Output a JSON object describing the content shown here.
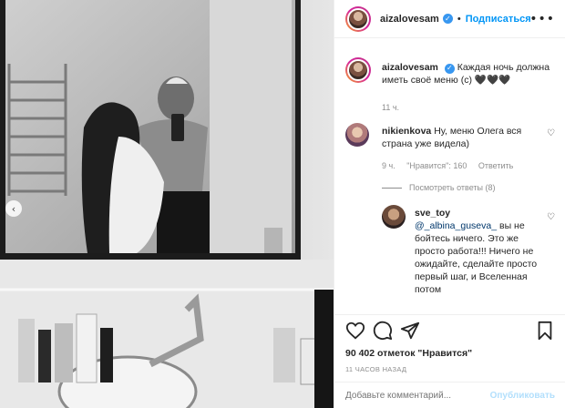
{
  "header": {
    "username": "aizalovesam",
    "separator": "•",
    "follow_label": "Подписаться",
    "more_label": "•••"
  },
  "photo": {
    "carousel_prev_glyph": "‹"
  },
  "caption": {
    "username": "aizalovesam",
    "text": "Каждая ночь должна иметь своё меню (с) 🖤🖤🖤",
    "time": "11 ч."
  },
  "comments": [
    {
      "username": "nikienkova",
      "text": "Ну, меню Олега вся страна уже видела)",
      "time": "9 ч.",
      "likes": "\"Нравится\": 160",
      "reply_label": "Ответить",
      "view_replies": "Посмотреть ответы (8)"
    },
    {
      "username": "sve_toy",
      "mention": "@_albina_guseva_",
      "text": "вы не бойтесь ничего. Это же просто работа!!! Ничего не ожидайте, сделайте просто первый шаг, и Вселенная потом"
    }
  ],
  "post": {
    "likes_count": "90 402 отметок \"Нравится\"",
    "date": "11 ЧАСОВ НАЗАД",
    "comment_placeholder": "Добавьте комментарий...",
    "publish_label": "Опубликовать"
  },
  "icons": {
    "verified": "verified-badge-icon",
    "like": "heart-icon",
    "comment": "comment-icon",
    "share": "share-icon",
    "save": "bookmark-icon"
  },
  "colors": {
    "accent": "#0095f6",
    "verified": "#3897f0",
    "muted_text": "#8e8e8e",
    "border": "#efefef"
  }
}
